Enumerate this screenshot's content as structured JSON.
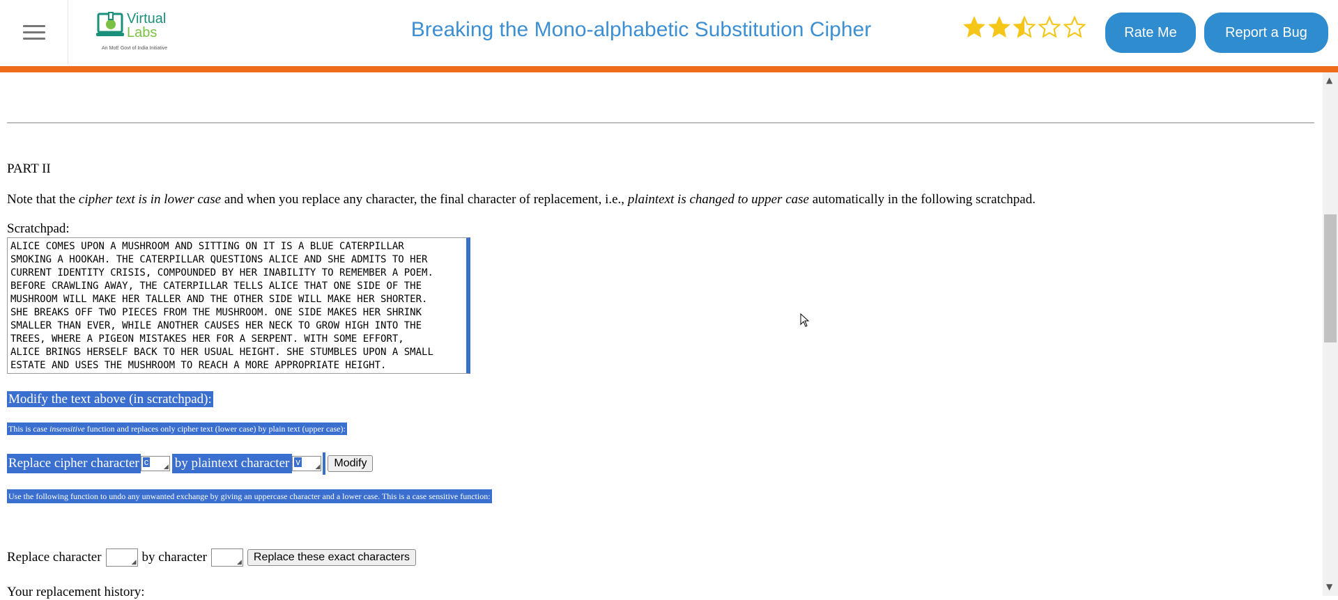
{
  "header": {
    "logo_title_1": "Virtual",
    "logo_title_2": "Labs",
    "logo_tagline": "An MoE Govt of India Initiative",
    "title": "Breaking the Mono-alphabetic Substitution Cipher",
    "rating": 2.5,
    "rating_max": 5,
    "rate_button": "Rate Me",
    "bug_button": "Report a Bug"
  },
  "content": {
    "part_heading": "PART II",
    "note_prefix": "Note that the ",
    "note_em1": "cipher text is in lower case",
    "note_mid": " and when you replace any character, the final character of replacement, i.e., ",
    "note_em2": "plaintext is changed to upper case",
    "note_suffix": " automatically in the following scratchpad.",
    "scratchpad_label": "Scratchpad:",
    "scratchpad_text": "ALICE COMES UPON A MUSHROOM AND SITTING ON IT IS A BLUE CATERPILLAR\nSMOKING A HOOKAH. THE CATERPILLAR QUESTIONS ALICE AND SHE ADMITS TO HER\nCURRENT IDENTITY CRISIS, COMPOUNDED BY HER INABILITY TO REMEMBER A POEM.\nBEFORE CRAWLING AWAY, THE CATERPILLAR TELLS ALICE THAT ONE SIDE OF THE\nMUSHROOM WILL MAKE HER TALLER AND THE OTHER SIDE WILL MAKE HER SHORTER.\nSHE BREAKS OFF TWO PIECES FROM THE MUSHROOM. ONE SIDE MAKES HER SHRINK\nSMALLER THAN EVER, WHILE ANOTHER CAUSES HER NECK TO GROW HIGH INTO THE\nTREES, WHERE A PIGEON MISTAKES HER FOR A SERPENT. WITH SOME EFFORT,\nALICE BRINGS HERSELF BACK TO HER USUAL HEIGHT. SHE STUMBLES UPON A SMALL\nESTATE AND USES THE MUSHROOM TO REACH A MORE APPROPRIATE HEIGHT.",
    "modify_heading": "Modify the text above (in scratchpad):",
    "case_note_prefix": "This is case ",
    "case_note_em": "insensitive",
    "case_note_suffix": " function and replaces only cipher text (lower case) by plain text (upper case):",
    "replace_cipher_label": "Replace cipher character",
    "cipher_char_value": "c",
    "by_plaintext_label": "by plaintext character",
    "plaintext_char_value": "v",
    "modify_button": "Modify",
    "undo_note": "Use the following function to undo any unwanted exchange by giving an uppercase character and a lower case. This is a case sensitive function:",
    "replace_char_label": "Replace character",
    "by_char_label": "by character",
    "replace_exact_button": "Replace these exact characters",
    "history_label": "Your replacement history:"
  }
}
